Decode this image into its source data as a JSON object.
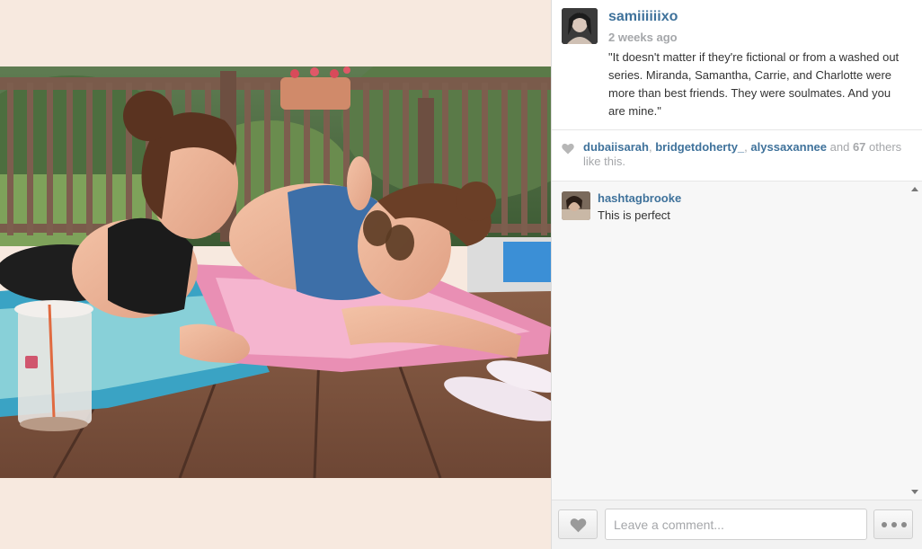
{
  "post": {
    "username": "samiiiiiixo",
    "time": "2 weeks ago",
    "caption": "\"It doesn't matter if they're fictional or from a washed out series. Miranda, Samantha, Carrie, and Charlotte were more than best friends. They were soulmates. And you are mine.\""
  },
  "likes": {
    "users": [
      "dubaiisarah",
      "bridgetdoherty_",
      "alyssaxannee"
    ],
    "and": "and",
    "count": "67",
    "suffix": "others like this."
  },
  "comments": [
    {
      "user": "hashtagbrooke",
      "text": "This is perfect"
    }
  ],
  "footer": {
    "comment_placeholder": "Leave a comment..."
  },
  "colors": {
    "link": "#3f729b",
    "muted": "#a5a7aa",
    "photo_background": "#f7e9df"
  },
  "icons": {
    "like": "heart-icon",
    "more": "more-dots-icon"
  }
}
